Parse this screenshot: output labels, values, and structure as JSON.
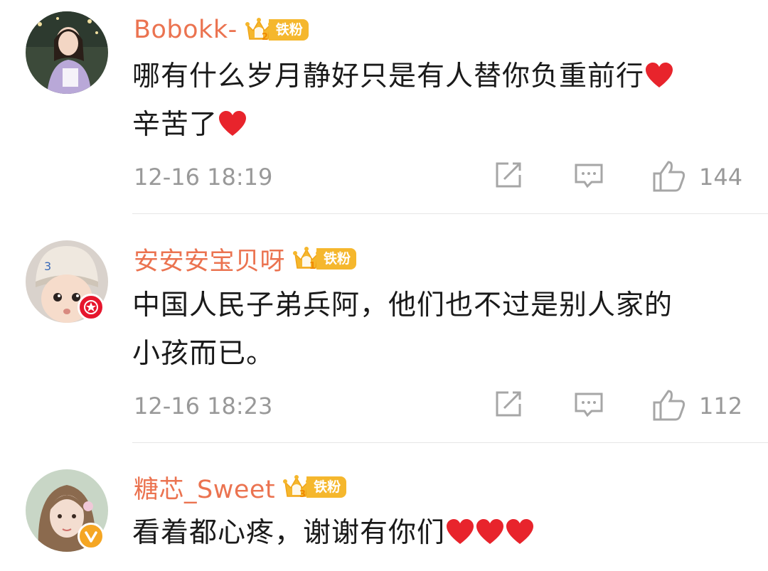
{
  "comments": [
    {
      "username": "Bobokk-",
      "fan_badge": "铁粉",
      "fan_level": "2",
      "text_lines": [
        "哪有什么岁月静好只是有人替你负重前行",
        "辛苦了"
      ],
      "timestamp": "12-16 18:19",
      "likes": "144",
      "verified": "none"
    },
    {
      "username": "安安安宝贝呀",
      "fan_badge": "铁粉",
      "fan_level": "1",
      "text_lines": [
        "中国人民子弟兵阿，他们也不过是别人家的",
        "小孩而已。"
      ],
      "timestamp": "12-16 18:23",
      "likes": "112",
      "verified": "red-star"
    },
    {
      "username": "糖芯_Sweet",
      "fan_badge": "铁粉",
      "fan_level": "3",
      "text_lines": [
        "看着都心疼，谢谢有你们"
      ],
      "verified": "orange-v"
    }
  ],
  "colors": {
    "username": "#eb7350",
    "badge": "#f5b72d",
    "meta": "#999999",
    "text": "#1a1a1a",
    "heart": "#e8242c"
  },
  "icons": [
    "repost-icon",
    "comment-icon",
    "like-icon",
    "heart-emoji"
  ]
}
